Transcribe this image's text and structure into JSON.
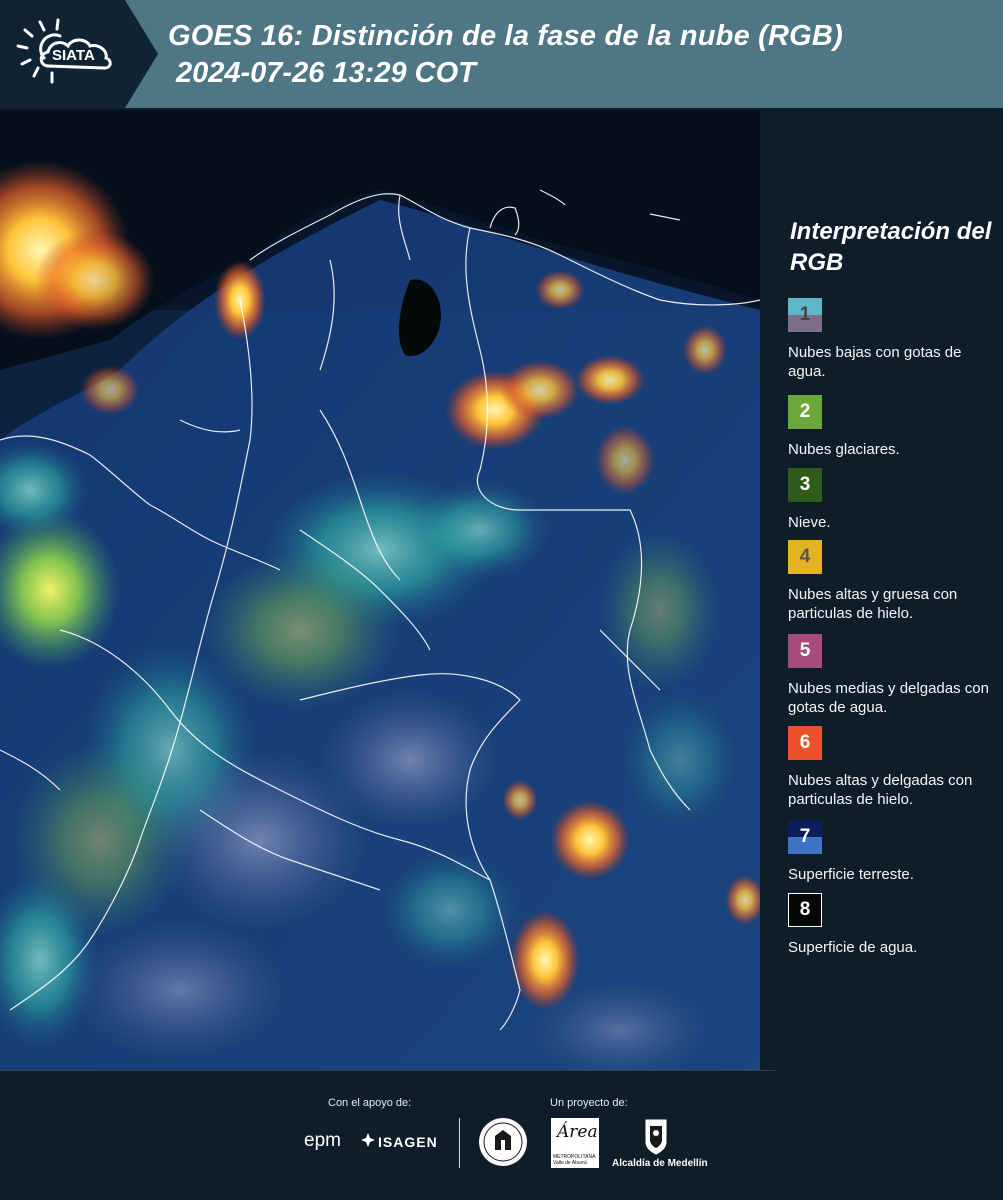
{
  "header": {
    "logo_text": "SIATA",
    "title": "GOES 16: Distinción de la fase de la nube (RGB)",
    "subtitle": "2024-07-26 13:29 COT"
  },
  "legend": {
    "title": "Interpretación del RGB",
    "items": [
      {
        "number": "1",
        "label": "Nubes bajas con gotas de agua.",
        "color_top": "#5fb6c6",
        "color_bottom": "#7d6f87"
      },
      {
        "number": "2",
        "label": "Nubes glaciares.",
        "color": "#6aa83a"
      },
      {
        "number": "3",
        "label": "Nieve.",
        "color": "#2f5c1c"
      },
      {
        "number": "4",
        "label": "Nubes altas y gruesa con particulas de hielo.",
        "color": "#e3b227"
      },
      {
        "number": "5",
        "label": "Nubes medias y delgadas con gotas de agua.",
        "color": "#a64b7c"
      },
      {
        "number": "6",
        "label": "Nubes altas y delgadas con particulas de hielo.",
        "color": "#e8532b"
      },
      {
        "number": "7",
        "label": "Superficie terreste.",
        "color_top": "#0b1e5c",
        "color_bottom": "#3f73c7"
      },
      {
        "number": "8",
        "label": "Superficie de agua.",
        "color": "#050805"
      }
    ]
  },
  "footer": {
    "support_label": "Con el apoyo de:",
    "project_label": "Un proyecto de:",
    "sponsors": {
      "epm": "epm",
      "isagen": "ISAGEN"
    },
    "area_logo": {
      "main": "Área",
      "sub": "METROPOLITANA Valle de Aburrá"
    },
    "alcaldia": "Alcaldía de Medellín"
  }
}
